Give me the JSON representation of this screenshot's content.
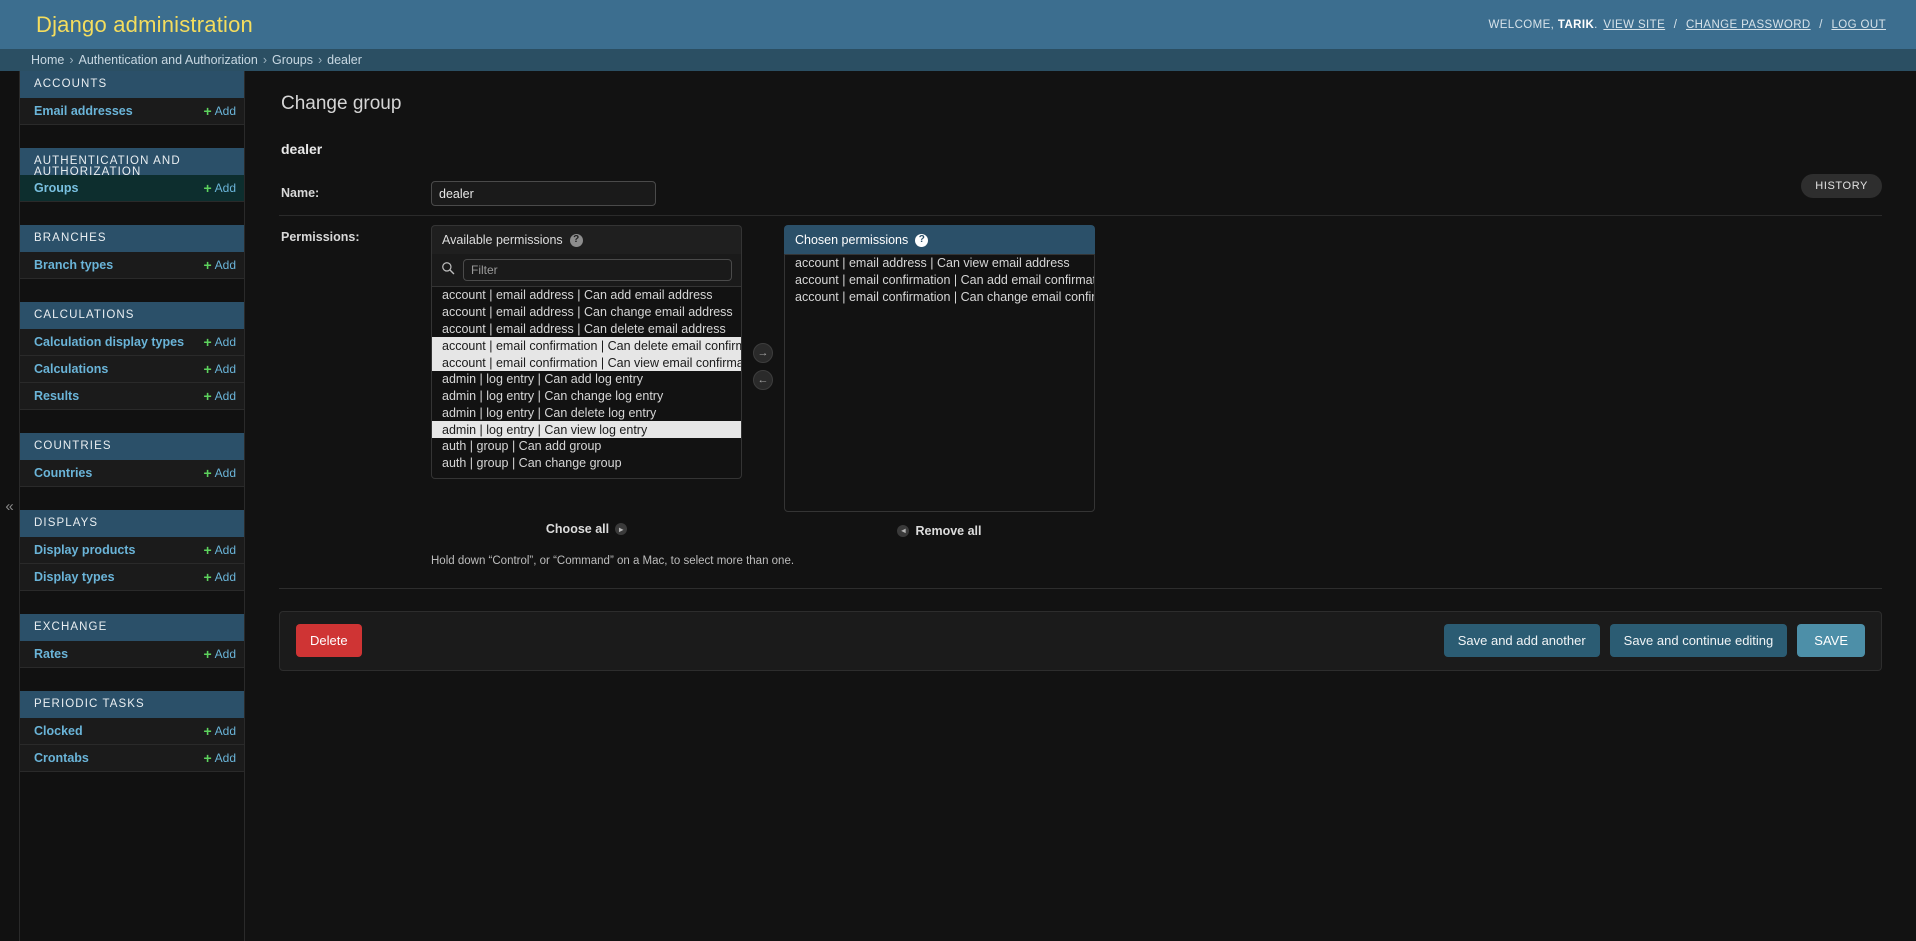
{
  "header": {
    "site_name": "Django administration",
    "welcome_prefix": "WELCOME,",
    "username": "TARIK",
    "username_suffix": ".",
    "view_site": "VIEW SITE",
    "change_password": "CHANGE PASSWORD",
    "log_out": "LOG OUT",
    "separator": "/"
  },
  "breadcrumbs": {
    "items": [
      {
        "label": "Home"
      },
      {
        "label": "Authentication and Authorization"
      },
      {
        "label": "Groups"
      },
      {
        "label": "dealer"
      }
    ],
    "separator": "›"
  },
  "sidebar": {
    "toggle_icon": "«",
    "add_label": "Add",
    "plus_icon": "+",
    "apps": [
      {
        "caption": "ACCOUNTS",
        "models": [
          {
            "name": "Email addresses",
            "current": false,
            "has_add": true
          }
        ]
      },
      {
        "caption": "AUTHENTICATION AND AUTHORIZATION",
        "models": [
          {
            "name": "Groups",
            "current": true,
            "has_add": true
          }
        ]
      },
      {
        "caption": "BRANCHES",
        "models": [
          {
            "name": "Branch types",
            "current": false,
            "has_add": true
          }
        ]
      },
      {
        "caption": "CALCULATIONS",
        "models": [
          {
            "name": "Calculation display types",
            "current": false,
            "has_add": true
          },
          {
            "name": "Calculations",
            "current": false,
            "has_add": true
          },
          {
            "name": "Results",
            "current": false,
            "has_add": true
          }
        ]
      },
      {
        "caption": "COUNTRIES",
        "models": [
          {
            "name": "Countries",
            "current": false,
            "has_add": true
          }
        ]
      },
      {
        "caption": "DISPLAYS",
        "models": [
          {
            "name": "Display products",
            "current": false,
            "has_add": true
          },
          {
            "name": "Display types",
            "current": false,
            "has_add": true
          }
        ]
      },
      {
        "caption": "EXCHANGE",
        "models": [
          {
            "name": "Rates",
            "current": false,
            "has_add": true
          }
        ]
      },
      {
        "caption": "PERIODIC TASKS",
        "models": [
          {
            "name": "Clocked",
            "current": false,
            "has_add": true
          },
          {
            "name": "Crontabs",
            "current": false,
            "has_add": true
          }
        ]
      }
    ]
  },
  "main": {
    "content_title": "Change group",
    "object_name": "dealer",
    "history_label": "HISTORY",
    "name_field": {
      "label": "Name:",
      "value": "dealer"
    },
    "permissions_field": {
      "label": "Permissions:"
    },
    "selector": {
      "available_title": "Available permissions",
      "chosen_title": "Chosen permissions",
      "help_icon": "?",
      "filter_placeholder": "Filter",
      "filter_value": "",
      "search_icon": "search-icon",
      "add_arrow": "→",
      "remove_arrow": "←",
      "choose_all_label": "Choose all",
      "remove_all_label": "Remove all",
      "help_text": "Hold down “Control”, or “Command” on a Mac, to select more than one.",
      "available": [
        {
          "label": "account | email address | Can add email address",
          "selected": false
        },
        {
          "label": "account | email address | Can change email address",
          "selected": false
        },
        {
          "label": "account | email address | Can delete email address",
          "selected": false
        },
        {
          "label": "account | email confirmation | Can delete email confirmation",
          "selected": true
        },
        {
          "label": "account | email confirmation | Can view email confirmation",
          "selected": true
        },
        {
          "label": "admin | log entry | Can add log entry",
          "selected": false
        },
        {
          "label": "admin | log entry | Can change log entry",
          "selected": false
        },
        {
          "label": "admin | log entry | Can delete log entry",
          "selected": false
        },
        {
          "label": "admin | log entry | Can view log entry",
          "selected": true
        },
        {
          "label": "auth | group | Can add group",
          "selected": false
        },
        {
          "label": "auth | group | Can change group",
          "selected": false
        }
      ],
      "chosen": [
        {
          "label": "account | email address | Can view email address",
          "selected": false
        },
        {
          "label": "account | email confirmation | Can add email confirmation",
          "selected": false
        },
        {
          "label": "account | email confirmation | Can change email confirmation",
          "selected": false
        }
      ]
    },
    "submit_row": {
      "delete_label": "Delete",
      "save_add_another_label": "Save and add another",
      "save_continue_label": "Save and continue editing",
      "save_label": "SAVE"
    }
  }
}
